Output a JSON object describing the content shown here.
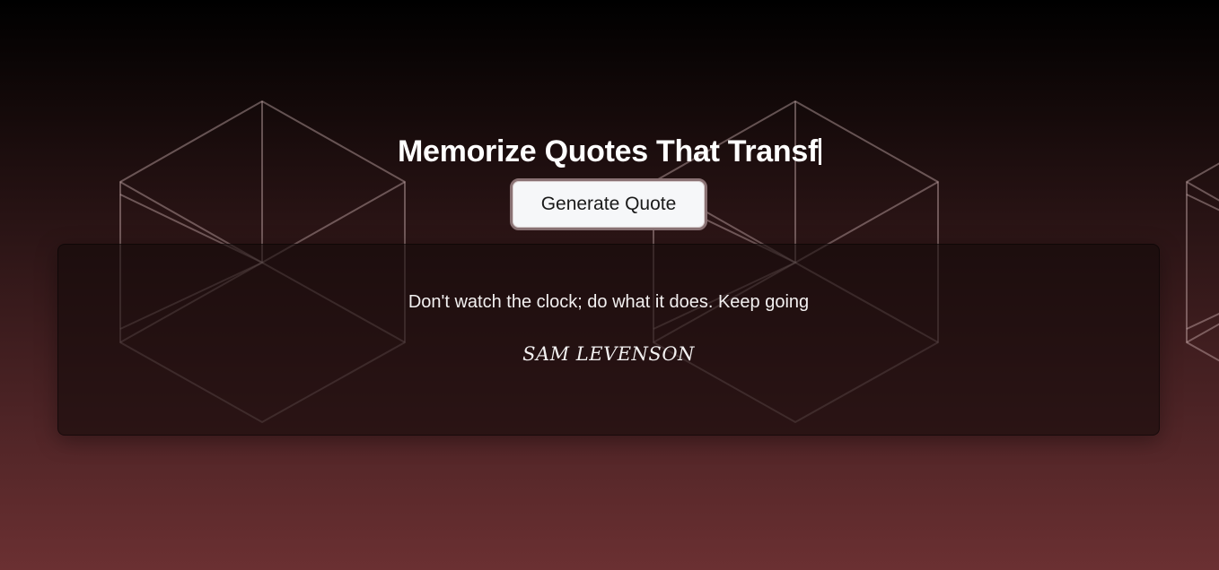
{
  "header": {
    "title": "Memorize Quotes That Transf"
  },
  "actions": {
    "generate_label": "Generate Quote"
  },
  "quote": {
    "text": "Don't watch the clock; do what it does. Keep going",
    "author": "SAM LEVENSON"
  },
  "colors": {
    "background_top": "#000000",
    "background_bottom": "#6b3032",
    "button_bg": "#f6f7f9",
    "text": "#ffffff"
  }
}
